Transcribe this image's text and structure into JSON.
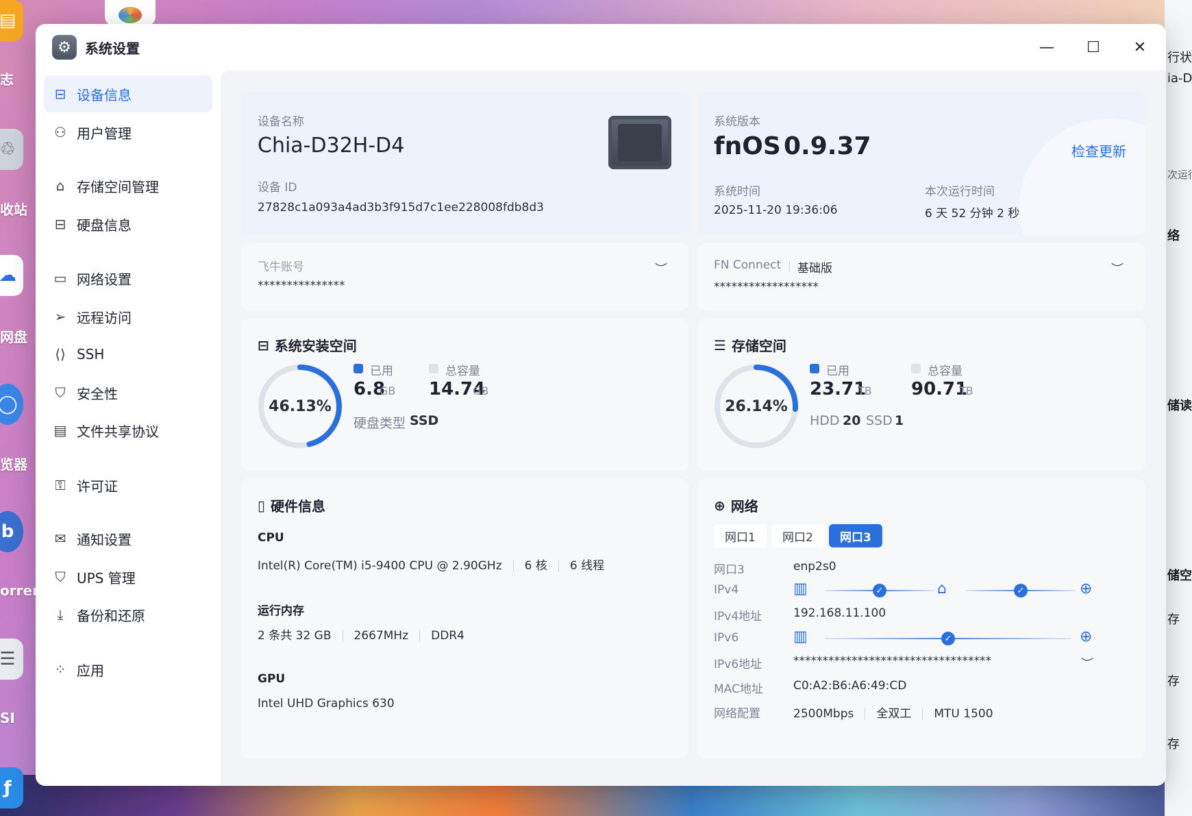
{
  "desktop": {
    "dock_labels": [
      "志",
      "收站",
      "网盘",
      "览器",
      "orrent",
      "SI"
    ],
    "right_peek_texts": [
      "行状",
      "ia-D",
      "次运行",
      "络",
      "储读",
      "储空",
      "存",
      "存",
      "存"
    ]
  },
  "window": {
    "title": "系统设置",
    "minimize_glyph": "—",
    "maximize_glyph": "☐",
    "close_glyph": "✕"
  },
  "sidebar": {
    "items": [
      {
        "label": "设备信息",
        "icon": "drive-icon",
        "glyph": "⊟",
        "active": true
      },
      {
        "label": "用户管理",
        "icon": "users-icon",
        "glyph": "⚇"
      },
      {
        "label": "存储空间管理",
        "icon": "storage-icon",
        "glyph": "⌂"
      },
      {
        "label": "硬盘信息",
        "icon": "disk-icon",
        "glyph": "⊟"
      },
      {
        "label": "网络设置",
        "icon": "network-icon",
        "glyph": "▭"
      },
      {
        "label": "远程访问",
        "icon": "send-icon",
        "glyph": "➢"
      },
      {
        "label": "SSH",
        "icon": "terminal-icon",
        "glyph": "⟨⟩"
      },
      {
        "label": "安全性",
        "icon": "shield-icon",
        "glyph": "⛉"
      },
      {
        "label": "文件共享协议",
        "icon": "file-icon",
        "glyph": "▤"
      },
      {
        "label": "许可证",
        "icon": "key-icon",
        "glyph": "⚿"
      },
      {
        "label": "通知设置",
        "icon": "mail-icon",
        "glyph": "✉"
      },
      {
        "label": "UPS 管理",
        "icon": "shield-outline-icon",
        "glyph": "⛉"
      },
      {
        "label": "备份和还原",
        "icon": "download-icon",
        "glyph": "⤓"
      },
      {
        "label": "应用",
        "icon": "apps-icon",
        "glyph": "⁘"
      }
    ]
  },
  "device": {
    "name_label": "设备名称",
    "name": "Chia-D32H-D4",
    "id_label": "设备 ID",
    "id": "27828c1a093a4ad3b3f915d7c1ee228008fdb8d3"
  },
  "system": {
    "version_label": "系统版本",
    "os": "fnOS",
    "version": "0.9.37",
    "check_update": "检查更新",
    "time_label": "系统时间",
    "time": "2025-11-20 19:36:06",
    "uptime_label": "本次运行时间",
    "uptime": "6 天 52 分钟 2 秒"
  },
  "account": {
    "label": "飞牛账号",
    "value": "***************",
    "eye_glyph": "︶"
  },
  "fn_connect": {
    "label": "FN Connect",
    "tier": "基础版",
    "value": "******************",
    "eye_glyph": "︶"
  },
  "sys_space": {
    "title": "系统安装空间",
    "percent_text": "46.13%",
    "percent": 46.13,
    "used_label": "已用",
    "used_value": "6.8",
    "used_unit": "GB",
    "total_label": "总容量",
    "total_value": "14.74",
    "total_unit": "GB",
    "disk_type_label": "硬盘类型",
    "disk_type": "SSD"
  },
  "storage": {
    "title": "存储空间",
    "percent_text": "26.14%",
    "percent": 26.14,
    "used_label": "已用",
    "used_value": "23.71",
    "used_unit": "TB",
    "total_label": "总容量",
    "total_value": "90.71",
    "total_unit": "TB",
    "hdd_label": "HDD",
    "hdd_count": "20",
    "ssd_label": "SSD",
    "ssd_count": "1"
  },
  "hardware": {
    "title": "硬件信息",
    "cpu_label": "CPU",
    "cpu_model": "Intel(R) Core(TM) i5-9400 CPU @ 2.90GHz",
    "cpu_cores": "6 核",
    "cpu_threads": "6 线程",
    "ram_label": "运行内存",
    "ram_size": "2 条共 32 GB",
    "ram_speed": "2667MHz",
    "ram_type": "DDR4",
    "gpu_label": "GPU",
    "gpu_model": "Intel UHD Graphics 630"
  },
  "network": {
    "title": "网络",
    "tabs": [
      "网口1",
      "网口2",
      "网口3"
    ],
    "active_tab": 2,
    "port_label": "网口3",
    "port_value": "enp2s0",
    "ipv4_label": "IPv4",
    "ipv4_addr_label": "IPv4地址",
    "ipv4_addr": "192.168.11.100",
    "ipv6_label": "IPv6",
    "ipv6_addr_label": "IPv6地址",
    "ipv6_addr": "**********************************",
    "mac_label": "MAC地址",
    "mac": "C0:A2:B6:A6:49:CD",
    "config_label": "网络配置",
    "speed": "2500Mbps",
    "duplex": "全双工",
    "mtu": "MTU 1500",
    "check_glyph": "✓",
    "globe_glyph": "⊕",
    "nas_glyph": "▥",
    "router_glyph": "⌂"
  },
  "colors": {
    "accent": "#2a6fdb",
    "ring_track": "#dfe2e8"
  }
}
